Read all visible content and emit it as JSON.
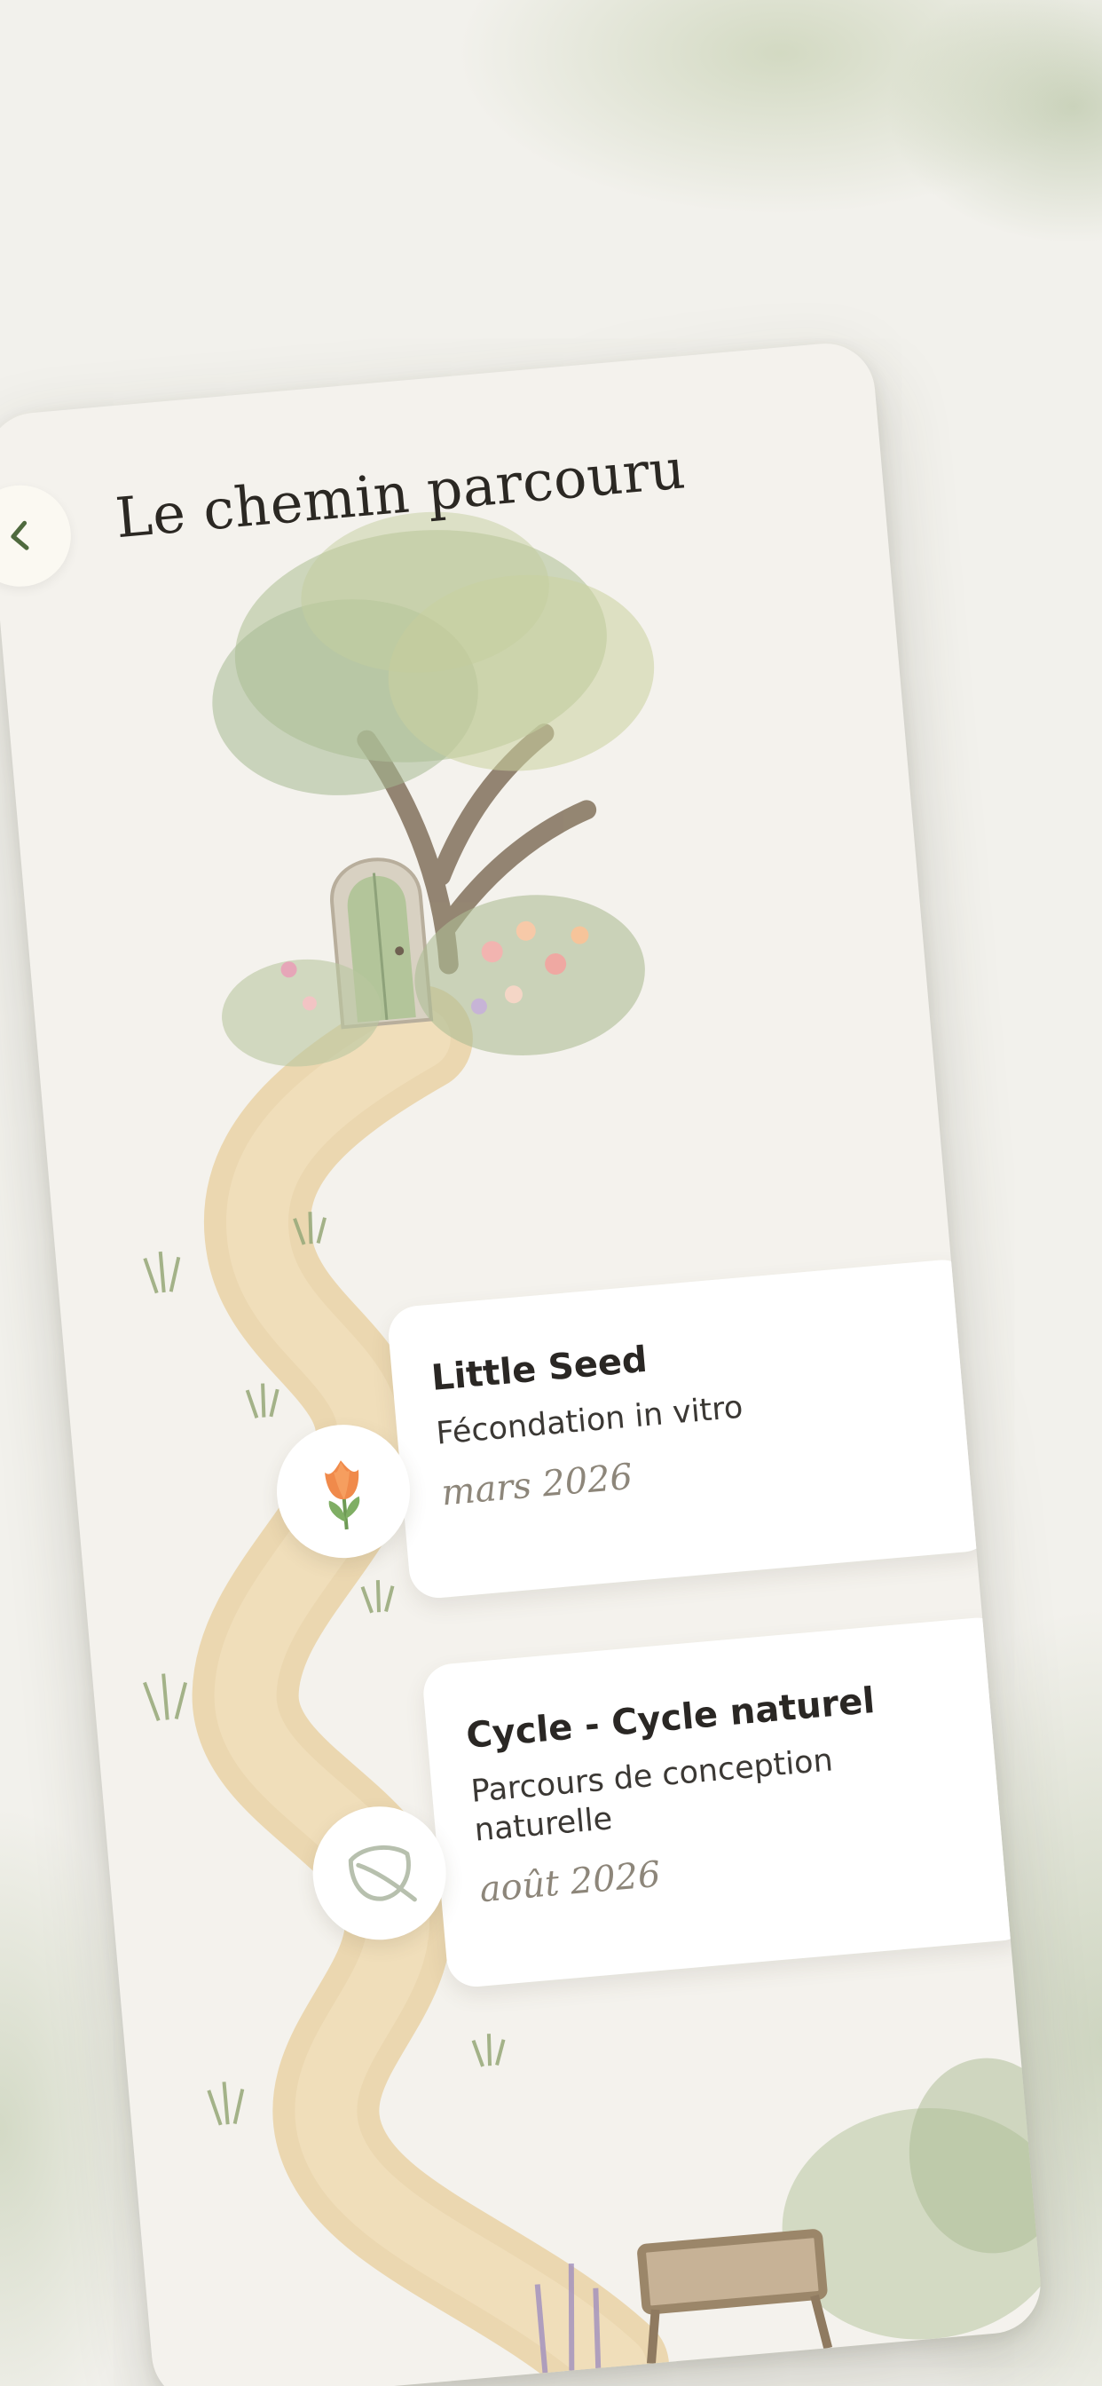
{
  "header": {
    "title": "Le chemin parcouru",
    "back_icon": "chevron-left-icon"
  },
  "timeline": [
    {
      "title": "Little Seed",
      "subtitle": "Fécondation in vitro",
      "date": "mars 2026",
      "icon": "tulip-icon"
    },
    {
      "title": "Cycle - Cycle naturel",
      "subtitle": "Parcours de conception naturelle",
      "date": "août 2026",
      "icon": "leaf-icon"
    }
  ],
  "colors": {
    "background": "#f2f1ec",
    "screen": "#f4f2ed",
    "card": "#ffffff",
    "path": "#e9d2a4",
    "foliage": "#9fb08a",
    "accent_tulip": "#f08a4b",
    "date_text": "#8d867a"
  }
}
